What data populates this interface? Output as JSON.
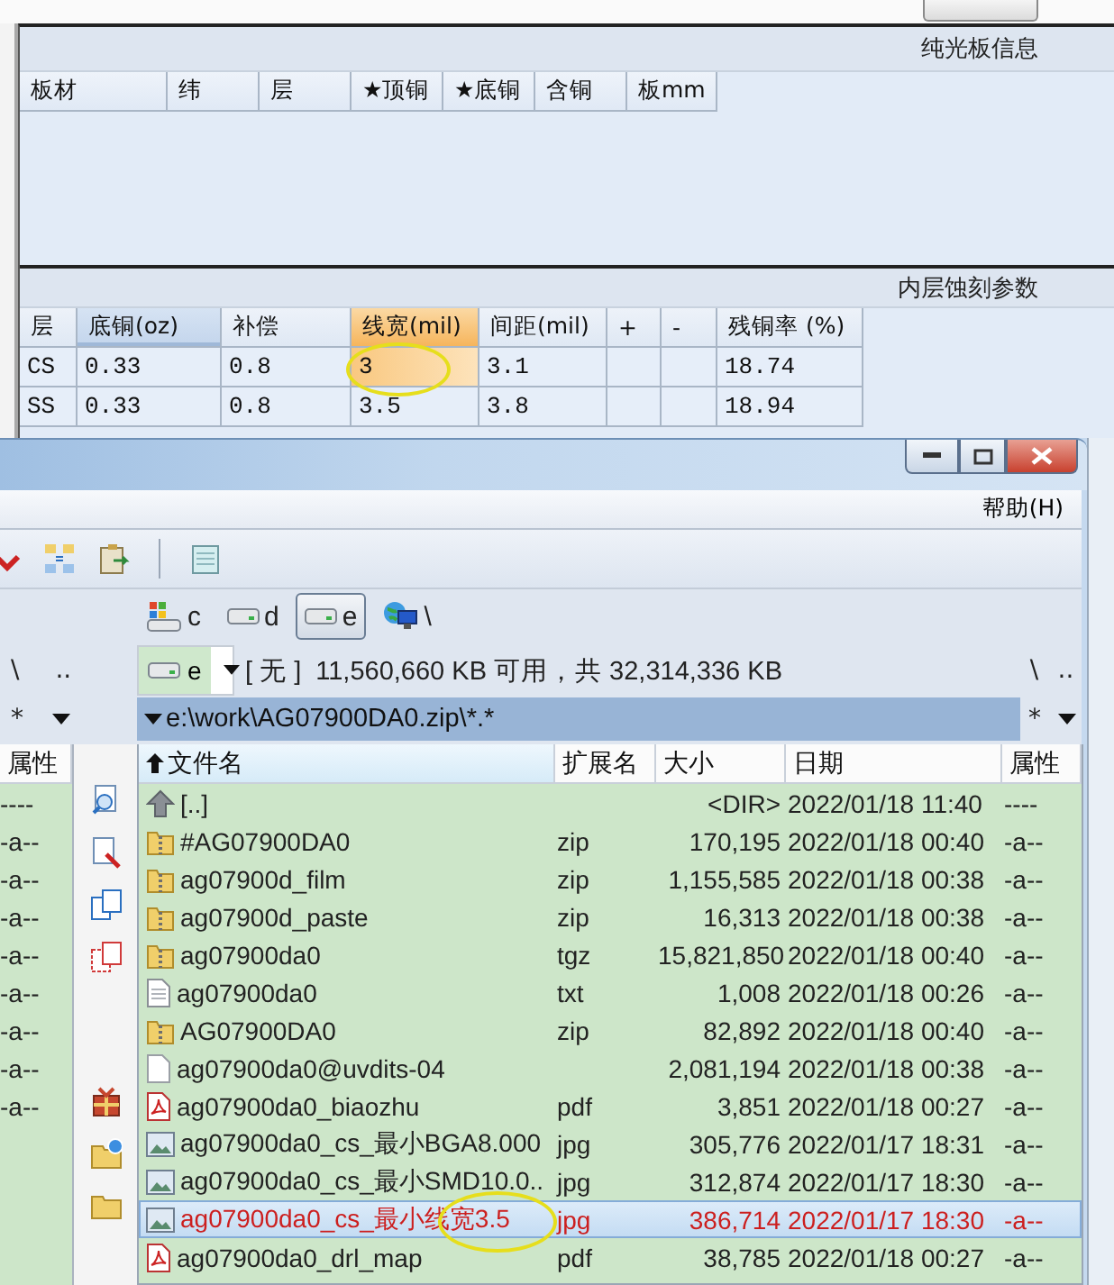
{
  "back_window": {
    "board_title": "纯光板信息",
    "board_columns": [
      "板材",
      "纬",
      "层",
      "★顶铜",
      "★底铜",
      "含铜",
      "板mm"
    ],
    "etch_title": "内层蚀刻参数",
    "etch_columns": [
      {
        "label": "层",
        "hovered": false,
        "selected": false
      },
      {
        "label": "底铜(oz)",
        "hovered": true,
        "selected": false
      },
      {
        "label": "补偿",
        "hovered": false,
        "selected": false
      },
      {
        "label": "线宽(mil)",
        "hovered": false,
        "selected": true
      },
      {
        "label": "间距(mil)",
        "hovered": false,
        "selected": false
      },
      {
        "label": "+",
        "hovered": false,
        "selected": false
      },
      {
        "label": "-",
        "hovered": false,
        "selected": false
      },
      {
        "label": "残铜率 (%)",
        "hovered": false,
        "selected": false
      }
    ],
    "etch_rows": [
      {
        "cells": [
          "CS",
          "0.33",
          "0.8",
          "3",
          "3.1",
          null,
          null,
          "18.74"
        ],
        "selected": true,
        "circled": true
      },
      {
        "cells": [
          "SS",
          "0.33",
          "0.8",
          "3.5",
          "3.8",
          null,
          null,
          "18.94"
        ],
        "selected": false,
        "circled": false
      }
    ]
  },
  "file_manager": {
    "menu": [
      "帮助(H)"
    ],
    "drives": [
      {
        "letter": "c",
        "kind": "system",
        "selected": false
      },
      {
        "letter": "d",
        "kind": "disk",
        "selected": false
      },
      {
        "letter": "e",
        "kind": "disk",
        "selected": true
      },
      {
        "letter": "\\",
        "kind": "network",
        "selected": false
      }
    ],
    "left_panel": {
      "nav": [
        "\\",
        ".."
      ],
      "filter": "*",
      "column": "属性",
      "attributes": [
        "----",
        "-a--",
        "-a--",
        "-a--",
        "-a--",
        "-a--",
        "-a--",
        "-a--",
        "-a--"
      ]
    },
    "right_panel": {
      "drive": "e",
      "volume": "[ 无 ]",
      "space": "11,560,660 KB 可用，共 32,314,336 KB",
      "path": "e:\\work\\AG07900DA0.zip\\*.*",
      "nav": [
        "\\",
        ".."
      ],
      "filter": "*",
      "columns": [
        {
          "label": "文件名",
          "sorted": true
        },
        {
          "label": "扩展名",
          "sorted": false
        },
        {
          "label": "大小",
          "sorted": false
        },
        {
          "label": "日期",
          "sorted": false
        },
        {
          "label": "属性",
          "sorted": false
        }
      ],
      "files": [
        {
          "name": "[..]",
          "kind": "up",
          "size": "<DIR>",
          "date": "2022/01/18 11:40",
          "attr": "----",
          "selected": false,
          "circled": false
        },
        {
          "name": "#AG07900DA0",
          "kind": "archive",
          "ext": "zip",
          "size": "170,195",
          "date": "2022/01/18 00:40",
          "attr": "-a--",
          "selected": false,
          "circled": false
        },
        {
          "name": "ag07900d_film",
          "kind": "archive",
          "ext": "zip",
          "size": "1,155,585",
          "date": "2022/01/18 00:38",
          "attr": "-a--",
          "selected": false,
          "circled": false
        },
        {
          "name": "ag07900d_paste",
          "kind": "archive",
          "ext": "zip",
          "size": "16,313",
          "date": "2022/01/18 00:38",
          "attr": "-a--",
          "selected": false,
          "circled": false
        },
        {
          "name": "ag07900da0",
          "kind": "archive",
          "ext": "tgz",
          "size": "15,821,850",
          "date": "2022/01/18 00:40",
          "attr": "-a--",
          "selected": false,
          "circled": false
        },
        {
          "name": "ag07900da0",
          "kind": "text",
          "ext": "txt",
          "size": "1,008",
          "date": "2022/01/18 00:26",
          "attr": "-a--",
          "selected": false,
          "circled": false
        },
        {
          "name": "AG07900DA0",
          "kind": "archive",
          "ext": "zip",
          "size": "82,892",
          "date": "2022/01/18 00:40",
          "attr": "-a--",
          "selected": false,
          "circled": false
        },
        {
          "name": "ag07900da0@uvdits-04",
          "kind": "blank",
          "size": "2,081,194",
          "date": "2022/01/18 00:38",
          "attr": "-a--",
          "selected": false,
          "circled": false
        },
        {
          "name": "ag07900da0_biaozhu",
          "kind": "pdf",
          "ext": "pdf",
          "size": "3,851",
          "date": "2022/01/18 00:27",
          "attr": "-a--",
          "selected": false,
          "circled": false
        },
        {
          "name": "ag07900da0_cs_最小BGA8.000",
          "kind": "image",
          "ext": "jpg",
          "size": "305,776",
          "date": "2022/01/17 18:31",
          "attr": "-a--",
          "selected": false,
          "circled": false
        },
        {
          "name": "ag07900da0_cs_最小SMD10.0..",
          "kind": "image",
          "ext": "jpg",
          "size": "312,874",
          "date": "2022/01/17 18:30",
          "attr": "-a--",
          "selected": false,
          "circled": false
        },
        {
          "name": "ag07900da0_cs_最小线宽3.5",
          "kind": "image",
          "ext": "jpg",
          "size": "386,714",
          "date": "2022/01/17 18:30",
          "attr": "-a--",
          "selected": true,
          "circled": true
        },
        {
          "name": "ag07900da0_drl_map",
          "kind": "pdf",
          "ext": "pdf",
          "size": "38,785",
          "date": "2022/01/18 00:27",
          "attr": "-a--",
          "selected": false,
          "circled": false
        }
      ]
    }
  }
}
